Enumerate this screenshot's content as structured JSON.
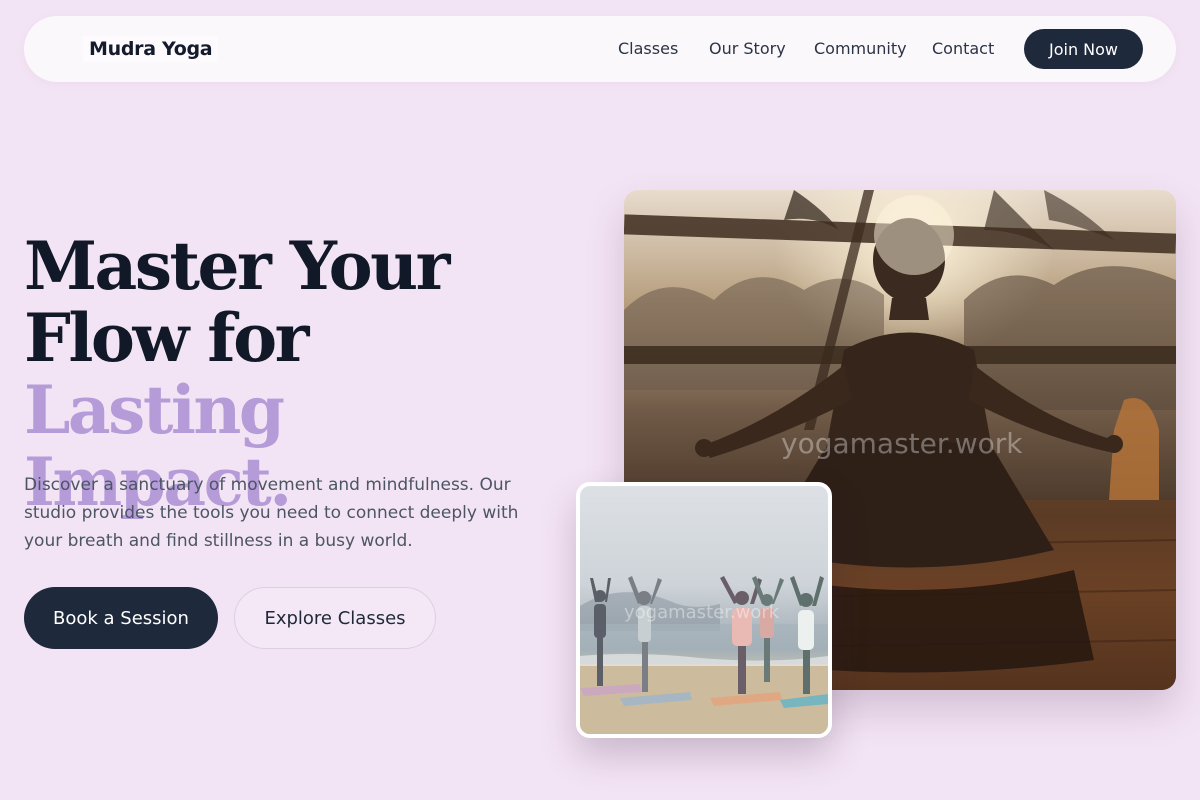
{
  "brand": {
    "name": "Mudra Yoga"
  },
  "nav": {
    "links": [
      "Classes",
      "Our Story",
      "Community",
      "Contact"
    ],
    "cta_label": "Join Now"
  },
  "hero": {
    "headline_line1": "Master Your",
    "headline_line2_dark": "Flow for ",
    "headline_line2_accent": "Lasting",
    "headline_line3_accent": "Impact.",
    "description": "Discover a sanctuary of movement and mindfulness. Our studio provides the tools you need to connect deeply with your breath and find stillness in a busy world.",
    "primary_button": "Book a Session",
    "secondary_button": "Explore Classes"
  },
  "images": {
    "main_watermark": "yogamaster.work",
    "secondary_watermark": "yogamaster.work"
  },
  "colors": {
    "background": "#f3e4f5",
    "primary_dark": "#1e293b",
    "accent_lavender": "#b59bd8"
  }
}
